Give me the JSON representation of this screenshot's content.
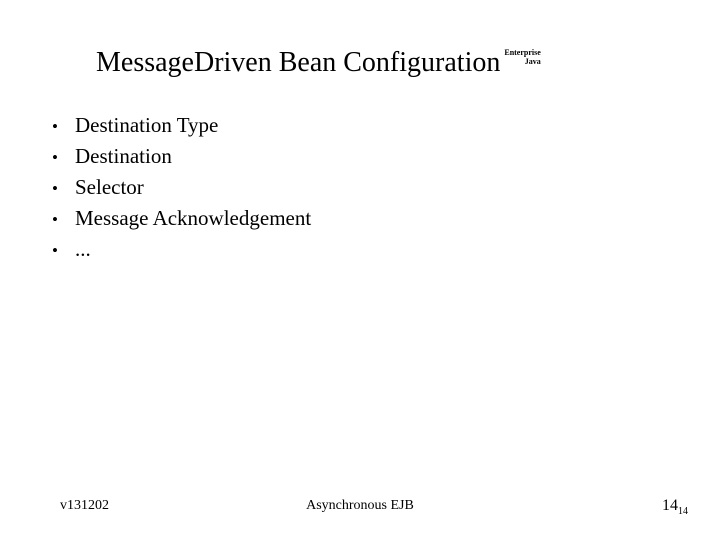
{
  "slide": {
    "title": "MessageDriven Bean Configuration",
    "brand": {
      "line1": "Enterprise",
      "line2": "Java"
    },
    "bullets": [
      {
        "glyph": "•",
        "text": "Destination Type"
      },
      {
        "glyph": "•",
        "text": "Destination"
      },
      {
        "glyph": "•",
        "text": "Selector"
      },
      {
        "glyph": "•",
        "text": "Message Acknowledgement"
      },
      {
        "glyph": "•",
        "text": "..."
      }
    ],
    "footer": {
      "version": "v131202",
      "topic": "Asynchronous EJB",
      "page_number": "14",
      "page_number_sub": "14"
    },
    "colors": {
      "background": "#ffffff",
      "text": "#000000"
    }
  }
}
